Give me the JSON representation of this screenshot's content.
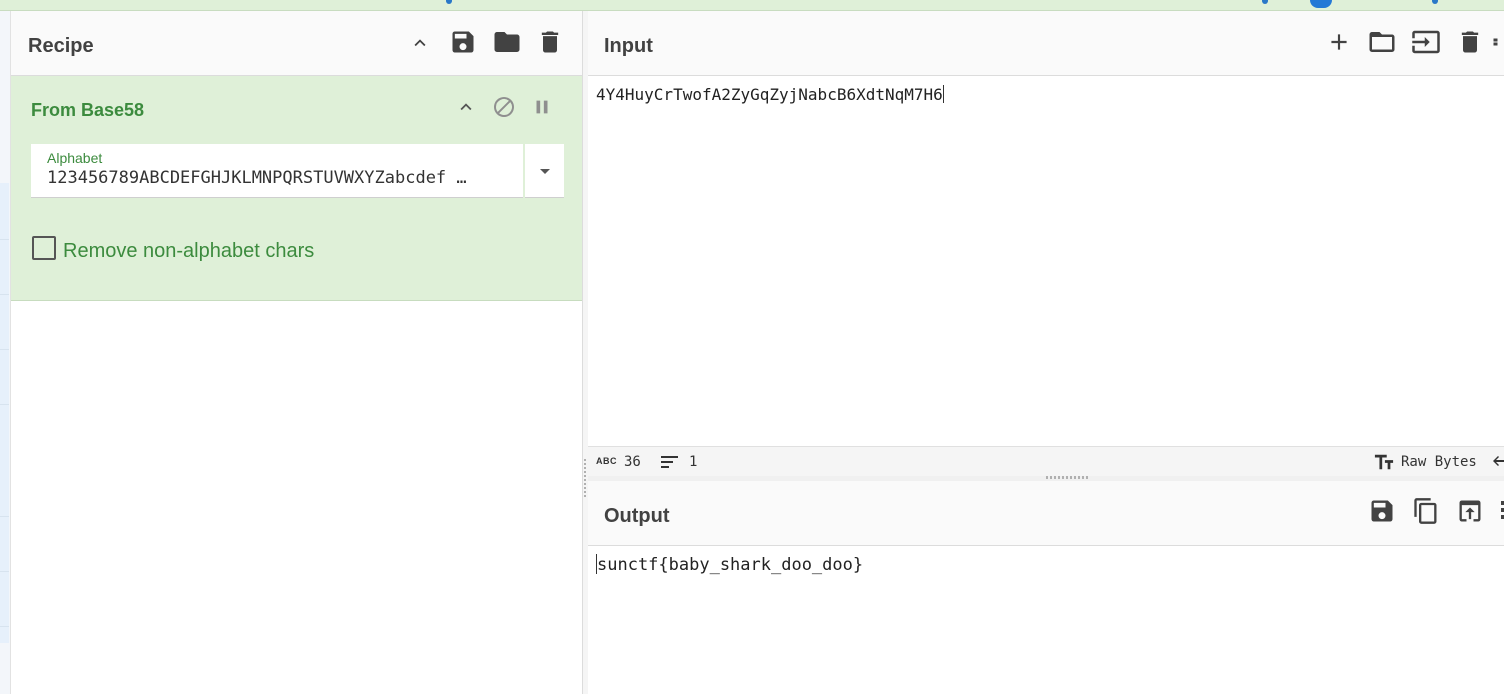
{
  "recipe": {
    "title": "Recipe",
    "icons": [
      "chevron-up-icon",
      "save-icon",
      "folder-icon",
      "trash-icon"
    ],
    "operation": {
      "name": "From Base58",
      "icons": [
        "chevron-up-icon",
        "disable-icon",
        "pause-icon"
      ],
      "alphabet": {
        "label": "Alphabet",
        "value": "123456789ABCDEFGHJKLMNPQRSTUVWXYZabcdef …"
      },
      "remove_non_alphabet": {
        "label": "Remove non-alphabet chars",
        "checked": false
      }
    }
  },
  "input": {
    "title": "Input",
    "icons": [
      "plus-icon",
      "folder-icon",
      "import-icon",
      "trash-icon"
    ],
    "text": "4Y4HuyCrTwofA2ZyGqZyjNabcB6XdtNqM7H6",
    "status": {
      "length_icon": "ABC",
      "length": "36",
      "lines": "1",
      "encoding": "Raw Bytes"
    }
  },
  "output": {
    "title": "Output",
    "icons": [
      "save-icon",
      "copy-icon",
      "replace-input-icon"
    ],
    "text": "sunctf{baby_shark_doo_doo}"
  },
  "colors": {
    "accent_green": "#3c8b3e",
    "operation_bg": "#dff0d8",
    "icon_dark": "#424242"
  }
}
